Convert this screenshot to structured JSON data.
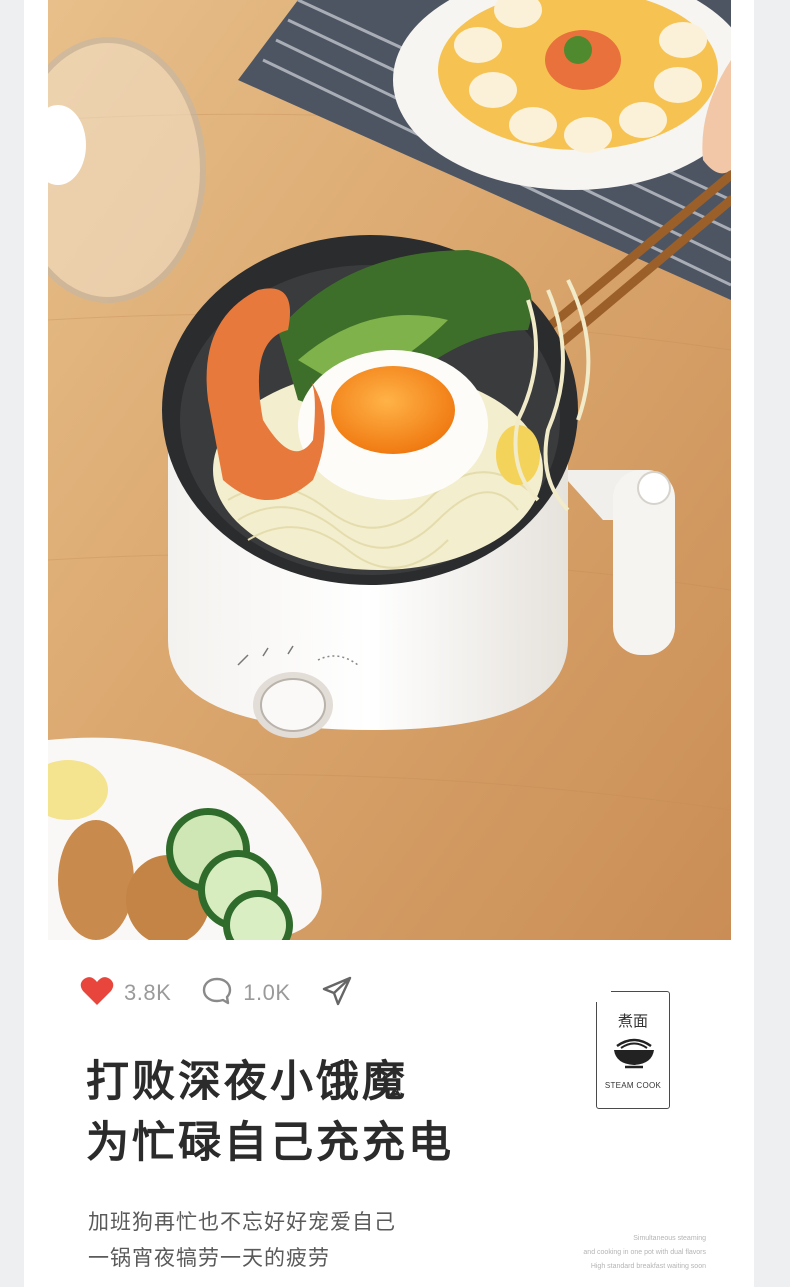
{
  "social": {
    "likes": "3.8K",
    "comments": "1.0K"
  },
  "headline": {
    "line1": "打败深夜小饿魔",
    "line2": "为忙碌自己充充电"
  },
  "description": {
    "line1": "加班狗再忙也不忘好好宠爱自己",
    "line2": "一锅宵夜犒劳一天的疲劳"
  },
  "badge": {
    "title": "煮面",
    "subtitle": "STEAM COOK"
  },
  "fine_print": {
    "line1": "Simultaneous steaming",
    "line2": "and cooking in one pot with dual flavors",
    "line3": "High standard breakfast waiting soon"
  },
  "colors": {
    "heart": "#e8453c",
    "text_dark": "#2b2b2b",
    "text_muted": "#9a9a9a"
  },
  "icons": [
    "heart-icon",
    "comment-icon",
    "share-icon",
    "noodle-bowl-icon"
  ]
}
